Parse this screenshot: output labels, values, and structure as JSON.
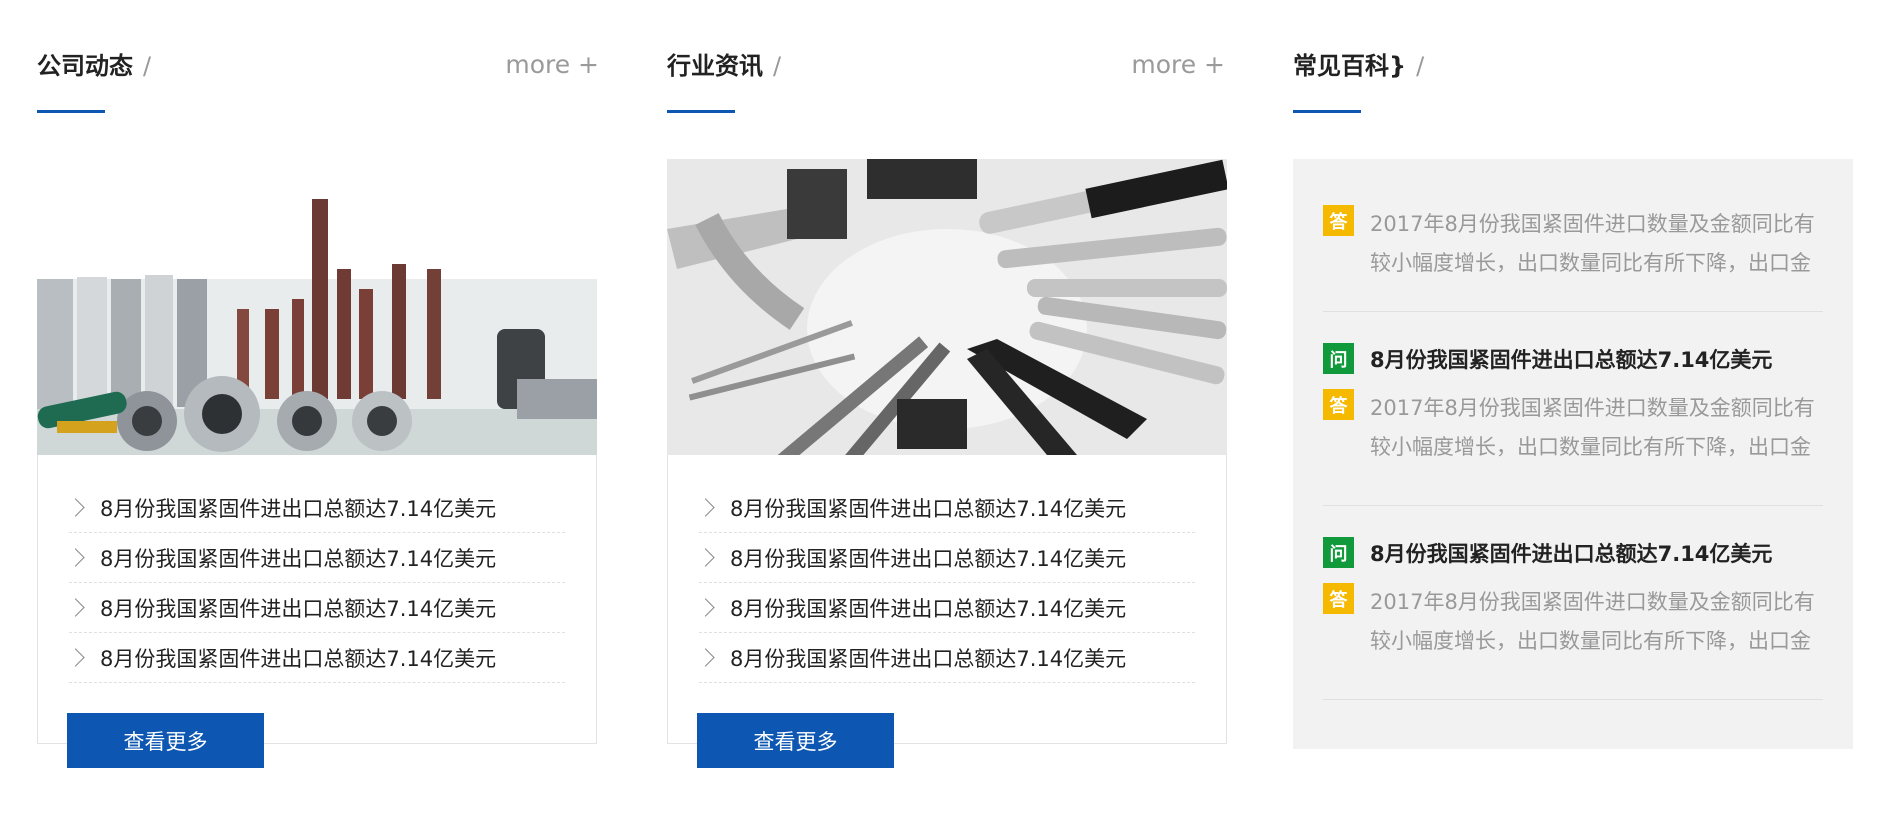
{
  "sections": {
    "company_news": {
      "title": "公司动态",
      "slash": "/",
      "more": "more +"
    },
    "industry_news": {
      "title": "行业资讯",
      "slash": "/",
      "more": "more +"
    },
    "faq": {
      "title": "常见百科}",
      "slash": "/"
    }
  },
  "company_news_list": [
    "8月份我国紧固件进出口总额达7.14亿美元",
    "8月份我国紧固件进出口总额达7.14亿美元",
    "8月份我国紧固件进出口总额达7.14亿美元",
    "8月份我国紧固件进出口总额达7.14亿美元"
  ],
  "industry_news_list": [
    "8月份我国紧固件进出口总额达7.14亿美元",
    "8月份我国紧固件进出口总额达7.14亿美元",
    "8月份我国紧固件进出口总额达7.14亿美元",
    "8月份我国紧固件进出口总额达7.14亿美元"
  ],
  "view_more_label": "查看更多",
  "faq_items": {
    "q_badge": "问",
    "a_badge": "答",
    "first_answer": "2017年8月份我国紧固件进口数量及金额同比有较小幅度增长，出口数量同比有所下降，出口金",
    "entries": [
      {
        "question": "8月份我国紧固件进出口总额达7.14亿美元",
        "answer": "2017年8月份我国紧固件进口数量及金额同比有较小幅度增长，出口数量同比有所下降，出口金"
      },
      {
        "question": "8月份我国紧固件进出口总额达7.14亿美元",
        "answer": "2017年8月份我国紧固件进口数量及金额同比有较小幅度增长，出口数量同比有所下降，出口金"
      }
    ]
  },
  "colors": {
    "accent": "#0d57b3",
    "answer_badge": "#f5b900",
    "question_badge": "#119a3c",
    "panel_bg": "#f2f2f2"
  },
  "images": {
    "company_news_photo": "socket-wrench-set-photo",
    "industry_news_photo": "wrenches-and-pliers-photo"
  }
}
